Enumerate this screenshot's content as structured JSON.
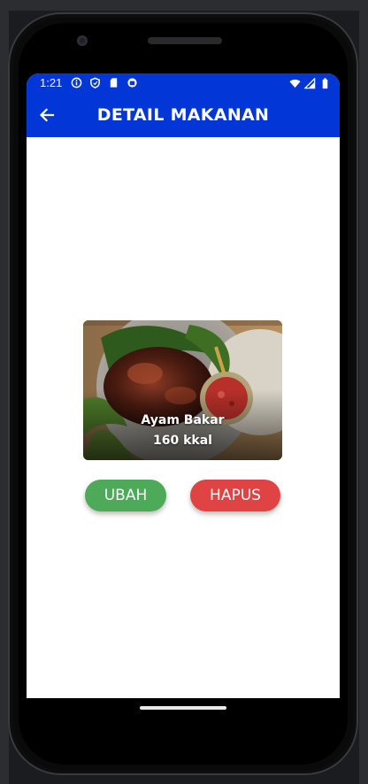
{
  "status_bar": {
    "time": "1:21",
    "left_icons": [
      "info-icon",
      "shield-icon",
      "sd-card-icon",
      "app-icon"
    ],
    "right_icons": [
      "wifi-icon",
      "signal-icon",
      "battery-icon"
    ]
  },
  "app_bar": {
    "title": "DETAIL MAKANAN",
    "back_icon": "arrow-back-icon",
    "color": "#0336d6"
  },
  "food": {
    "name": "Ayam Bakar",
    "calories": "160 kkal",
    "image": "grilled-chicken-photo"
  },
  "actions": {
    "edit_label": "UBAH",
    "delete_label": "HAPUS",
    "edit_color": "#4caa59",
    "delete_color": "#e04343"
  }
}
